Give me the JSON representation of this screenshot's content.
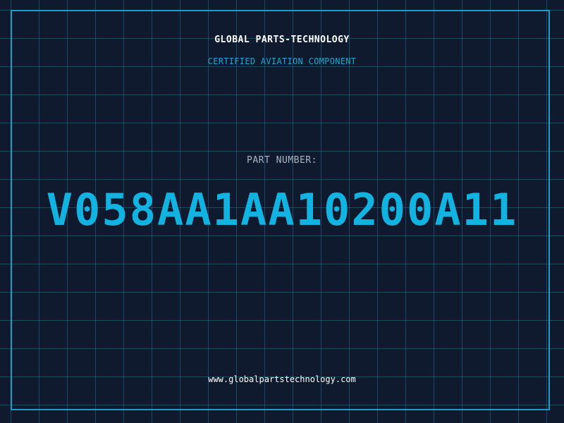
{
  "label": {
    "company": "GLOBAL PARTS-TECHNOLOGY",
    "subtitle": "CERTIFIED AVIATION COMPONENT",
    "part_number_label": "PART NUMBER:",
    "part_number": "V058AA1AA10200A11",
    "website": "www.globalpartstechnology.com"
  },
  "colors": {
    "background": "#101a2e",
    "grid": "#286e8c",
    "frame": "#1a9ec9",
    "accent": "#12b3e0",
    "heading": "#ffffff",
    "muted": "#a9b6c6"
  }
}
